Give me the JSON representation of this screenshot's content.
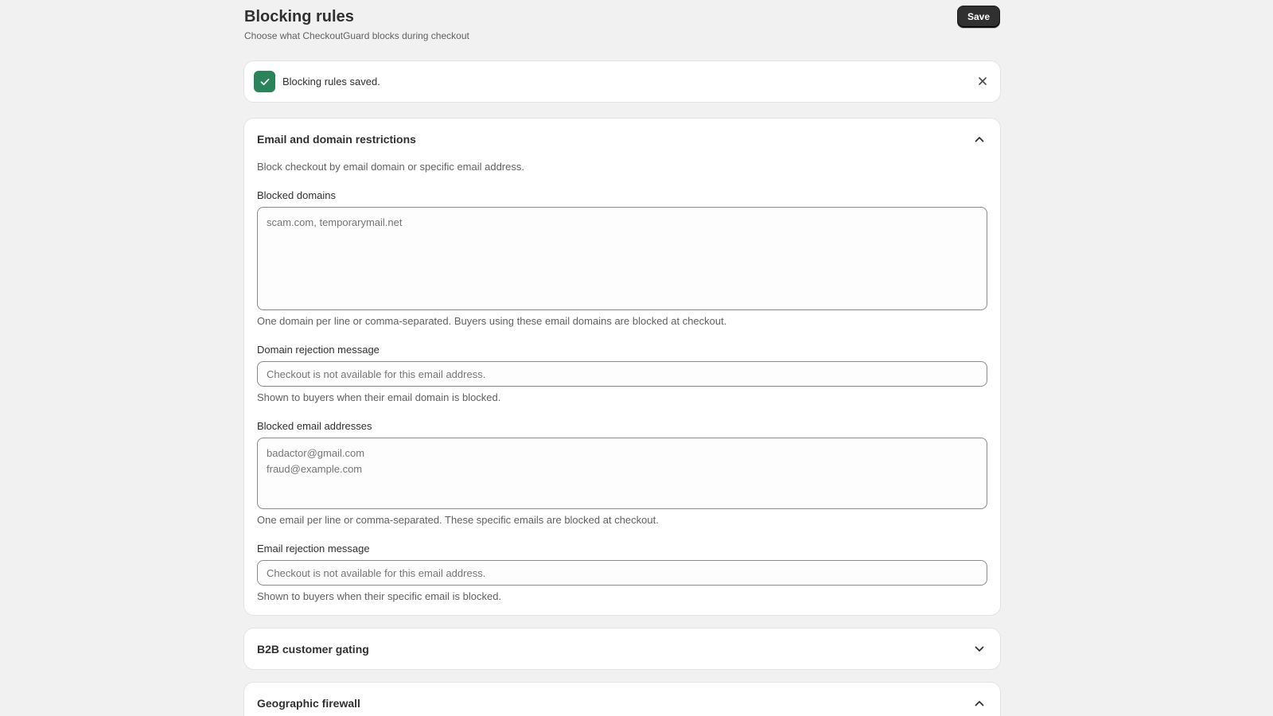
{
  "header": {
    "title": "Blocking rules",
    "subtitle": "Choose what CheckoutGuard blocks during checkout",
    "save_label": "Save"
  },
  "banner": {
    "message": "Blocking rules saved.",
    "icon": "check-icon",
    "accent_color": "#29845a"
  },
  "email_section": {
    "title": "Email and domain restrictions",
    "expanded": true,
    "description": "Block checkout by email domain or specific email address.",
    "blocked_domains": {
      "label": "Blocked domains",
      "placeholder": "scam.com, temporarymail.net",
      "help": "One domain per line or comma-separated. Buyers using these email domains are blocked at checkout."
    },
    "domain_message": {
      "label": "Domain rejection message",
      "placeholder": "Checkout is not available for this email address.",
      "help": "Shown to buyers when their email domain is blocked."
    },
    "blocked_emails": {
      "label": "Blocked email addresses",
      "placeholder": "badactor@gmail.com\nfraud@example.com",
      "help": "One email per line or comma-separated. These specific emails are blocked at checkout."
    },
    "email_message": {
      "label": "Email rejection message",
      "placeholder": "Checkout is not available for this email address.",
      "help": "Shown to buyers when their specific email is blocked."
    }
  },
  "b2b_section": {
    "title": "B2B customer gating",
    "expanded": false
  },
  "geo_section": {
    "title": "Geographic firewall",
    "expanded": true
  },
  "colors": {
    "background": "#f1f1f1",
    "primary_button": "#303030",
    "success": "#29845a"
  }
}
